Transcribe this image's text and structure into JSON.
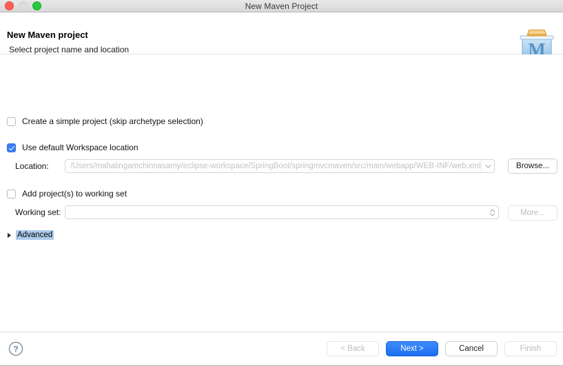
{
  "window": {
    "title": "New Maven Project",
    "traffic_lights": [
      {
        "name": "close",
        "color": "#ff5f57",
        "enabled": true
      },
      {
        "name": "minimize",
        "color": "#dddddd",
        "enabled": false
      },
      {
        "name": "zoom",
        "color": "#28c840",
        "enabled": true
      }
    ]
  },
  "header": {
    "title": "New Maven project",
    "subtitle": "Select project name and location",
    "icon": "maven-logo-icon"
  },
  "form": {
    "simple_project": {
      "label": "Create a simple project (skip archetype selection)",
      "checked": false
    },
    "default_workspace": {
      "label": "Use default Workspace location",
      "checked": true
    },
    "location": {
      "label": "Location:",
      "value": "/Users/mahalingamchinnasamy/eclipse-workspace/SpringBoot/springmvcmaven/src/main/webapp/WEB-INF/web.xml",
      "placeholder": "",
      "browse_label": "Browse...",
      "chevron": "chevron-down-icon"
    },
    "add_to_working_set": {
      "label": "Add project(s) to working set",
      "checked": false
    },
    "working_set": {
      "label": "Working set:",
      "value": "",
      "more_label": "More...",
      "more_enabled": false,
      "stepper": "stepper-updown-icon"
    },
    "advanced": {
      "label": "Advanced",
      "expanded": false,
      "selected": true,
      "disclosure": "triangle-right-icon"
    }
  },
  "footer": {
    "help": "help-question-icon",
    "buttons": [
      {
        "label": "< Back",
        "enabled": false,
        "primary": false
      },
      {
        "label": "Next >",
        "enabled": true,
        "primary": true
      },
      {
        "label": "Cancel",
        "enabled": true,
        "primary": false
      },
      {
        "label": "Finish",
        "enabled": false,
        "primary": false
      }
    ]
  },
  "colors": {
    "accent": "#1a6ef2",
    "checkbox_checked": "#3b7df6",
    "selection_highlight": "#aecbeb",
    "placeholder_text": "#c2c2c2"
  }
}
